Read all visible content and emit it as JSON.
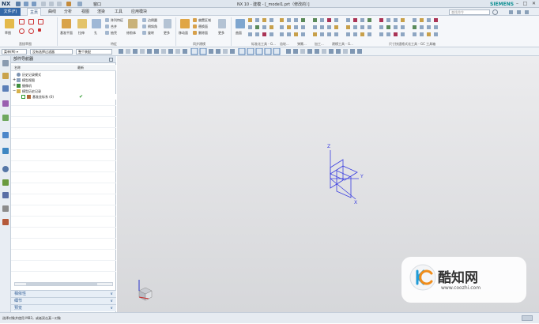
{
  "app": {
    "logo": "NX",
    "title": "NX 10 - 建模 - [_model1.prt（修改的）]",
    "brand": "SIEMENS",
    "window_menu": "窗口",
    "search_placeholder": "查找命令"
  },
  "menubar": {
    "file_tab": "文件(F)",
    "tabs": [
      "主页",
      "曲线",
      "分析",
      "视图",
      "渲染",
      "工具",
      "应用模块"
    ],
    "active": "主页"
  },
  "ribbon": {
    "groups": [
      "直接草图",
      "特征",
      "同步建模",
      "标准化工具 - G...",
      "齿轮...",
      "弹簧...",
      "加工...",
      "建模工具 - G...",
      "尺寸快速格式化工具 - GC 工具箱"
    ],
    "labels": {
      "sketch": "草图",
      "extrude": "拉伸",
      "revolve": "旋转",
      "hole": "孔",
      "unite": "合并",
      "edge_blend": "边倒圆",
      "chamfer": "倒斜角",
      "shell": "抽壳",
      "datum_plane": "基准平面",
      "array_feature": "阵列特征",
      "trim_body": "修剪体",
      "more": "更多",
      "move_face": "移动面",
      "replace_face": "替换面",
      "delete_face": "删除面",
      "offset_region": "偏置区域",
      "surface": "曲面"
    }
  },
  "toolbar2": {
    "menu": "菜单(M) ▾",
    "filter": "没有选择过滤器",
    "scope": "整个装配"
  },
  "navigator": {
    "title": "部件导航器",
    "col_name": "名称",
    "col_latest": "最新",
    "items": [
      {
        "label": "历史记录模式",
        "latest": ""
      },
      {
        "label": "模型视图",
        "latest": ""
      },
      {
        "label": "摄像机",
        "latest": ""
      },
      {
        "label": "模型历史记录",
        "latest": ""
      },
      {
        "label": "基准坐标系 (0)",
        "latest": "✔"
      }
    ],
    "panels": [
      "相依性",
      "细节",
      "预览"
    ]
  },
  "viewport": {
    "axes": {
      "x": "X",
      "y": "Y",
      "z": "Z"
    }
  },
  "status": {
    "text": "选择对象并使用 MB3，或者双击某一对象"
  },
  "watermark": {
    "brand": "酷知网",
    "url": "www.coozhi.com"
  },
  "colors": {
    "accent": "#3569a8",
    "datum": "#3b3fe0",
    "check": "#2e9a2e",
    "brand_teal": "#0e8f92"
  }
}
